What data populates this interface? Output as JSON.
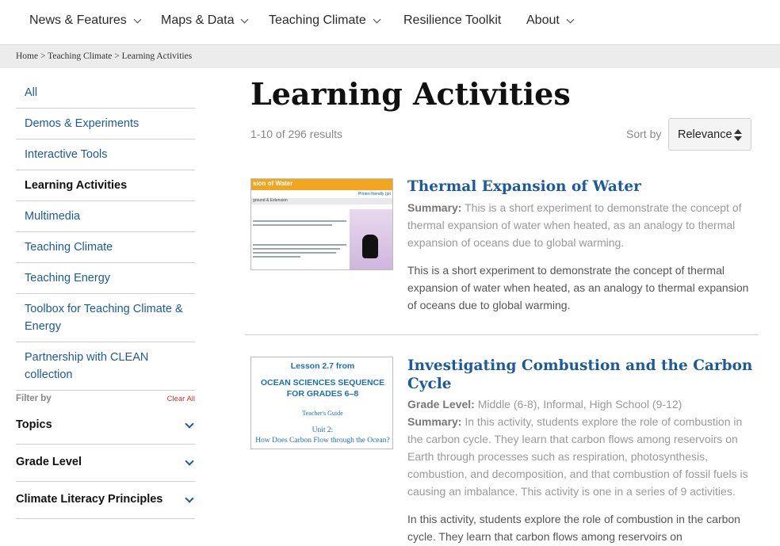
{
  "nav": {
    "items": [
      {
        "label": "News & Features",
        "dropdown": true
      },
      {
        "label": "Maps & Data",
        "dropdown": true
      },
      {
        "label": "Teaching Climate",
        "dropdown": true
      },
      {
        "label": "Resilience Toolkit",
        "dropdown": false
      },
      {
        "label": "About",
        "dropdown": true
      }
    ]
  },
  "breadcrumb": {
    "text": "Home > Teaching Climate > Learning Activities"
  },
  "sidebar": {
    "items": [
      {
        "label": "All",
        "active": false
      },
      {
        "label": "Demos & Experiments",
        "active": false
      },
      {
        "label": "Interactive Tools",
        "active": false
      },
      {
        "label": "Learning Activities",
        "active": true
      },
      {
        "label": "Multimedia",
        "active": false
      },
      {
        "label": "Teaching Climate",
        "active": false
      },
      {
        "label": "Teaching Energy",
        "active": false
      },
      {
        "label": "Toolbox for Teaching Climate & Energy",
        "active": false
      },
      {
        "label": "Partnership with CLEAN collection",
        "active": false
      }
    ],
    "filter_by": "Filter by",
    "clear_all": "Clear All",
    "facets": [
      "Topics",
      "Grade Level",
      "Climate Literacy Principles"
    ]
  },
  "main": {
    "title": "Learning Activities",
    "count": "1-10 of 296 results",
    "sort_label": "Sort by",
    "sort_value": "Relevance"
  },
  "results": [
    {
      "title": "Thermal Expansion of Water",
      "summary_label": "Summary:",
      "summary": "This is a short experiment to demonstrate the concept of thermal expansion of water when heated, as an analogy to thermal expansion of oceans due to global warming.",
      "description": "This is a short experiment to demonstrate the concept of thermal expansion of water when heated, as an analogy to thermal expansion of oceans due to global warming.",
      "thumb": {
        "header": "sion of Water",
        "printer": "Printer-friendly (pri",
        "sub": "ground & Extension"
      }
    },
    {
      "title": "Investigating Combustion and the Carbon Cycle",
      "grade_label": "Grade Level:",
      "grade": "Middle (6-8), Informal, High School (9-12)",
      "summary_label": "Summary:",
      "summary": "In this activity, students explore the role of combustion in the carbon cycle. They learn that carbon flows among reservoirs on Earth through processes such as respiration, photosynthesis, combustion, and decomposition, and that combustion of fossil fuels is causing an imbalance. This activity is one in a series of 9 activities.",
      "description": "In this activity, students explore the role of combustion in the carbon cycle. They learn that carbon flows among reservoirs on",
      "thumb": {
        "lesson": "Lesson 2.7 from",
        "seq1": "OCEAN SCIENCES SEQUENCE",
        "seq2": "FOR GRADES 6–8",
        "guide": "Teacher's Guide",
        "unit": "Unit 2:",
        "unit_title": "How Does Carbon Flow through the Ocean?"
      }
    }
  ],
  "colors": {
    "link": "#1b5a9c",
    "accent_orange": "#f2a51f",
    "clear_all": "#c0392b"
  }
}
